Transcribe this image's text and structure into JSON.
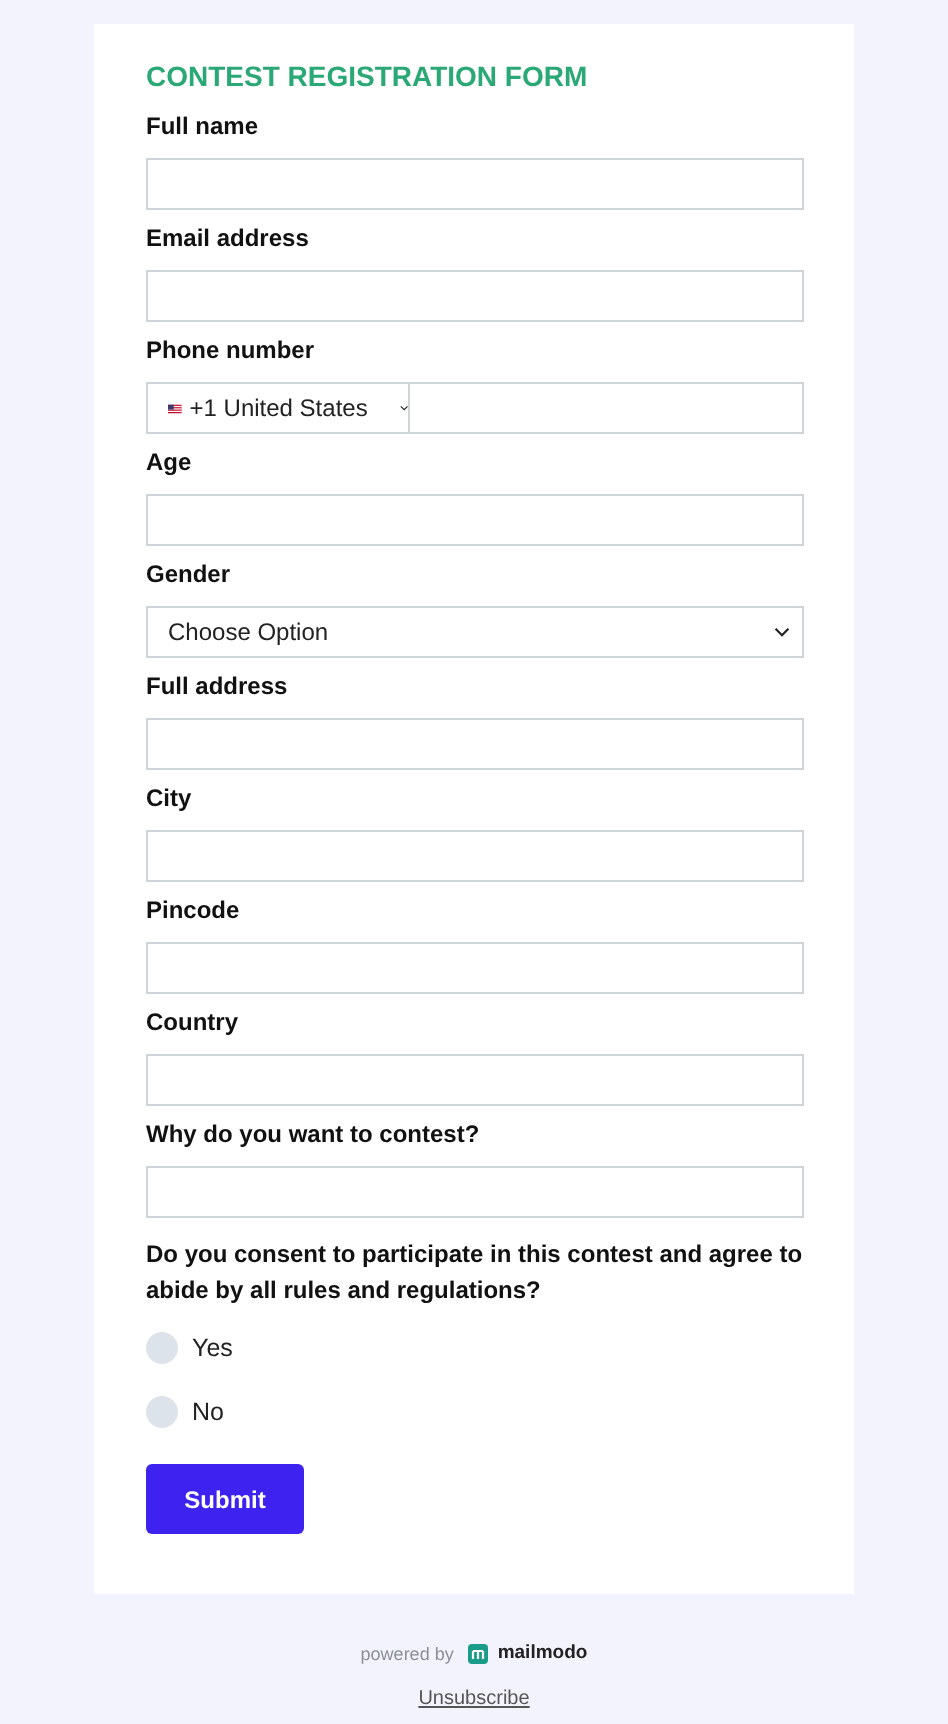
{
  "form": {
    "title": "CONTEST REGISTRATION FORM",
    "fields": [
      {
        "kind": "text",
        "label": "Full name"
      },
      {
        "kind": "text",
        "label": "Email address"
      },
      {
        "kind": "phone",
        "label": "Phone number",
        "country": "+1 United States"
      },
      {
        "kind": "text",
        "label": "Age"
      },
      {
        "kind": "select",
        "label": "Gender",
        "value": "Choose Option"
      },
      {
        "kind": "text",
        "label": "Full address"
      },
      {
        "kind": "text",
        "label": "City"
      },
      {
        "kind": "text",
        "label": "Pincode"
      },
      {
        "kind": "text",
        "label": "Country"
      },
      {
        "kind": "text",
        "label": "Why do you want to contest?"
      }
    ],
    "question": {
      "label": "Do you consent to participate in this contest and agree to abide by all rules and regulations?",
      "options": [
        {
          "label": "Yes",
          "selected": false
        },
        {
          "label": "No",
          "selected": false
        }
      ]
    },
    "submit": "Submit"
  },
  "footer": {
    "powered_by": "powered by",
    "brand": "mailmodo",
    "unsubscribe": "Unsubscribe"
  }
}
